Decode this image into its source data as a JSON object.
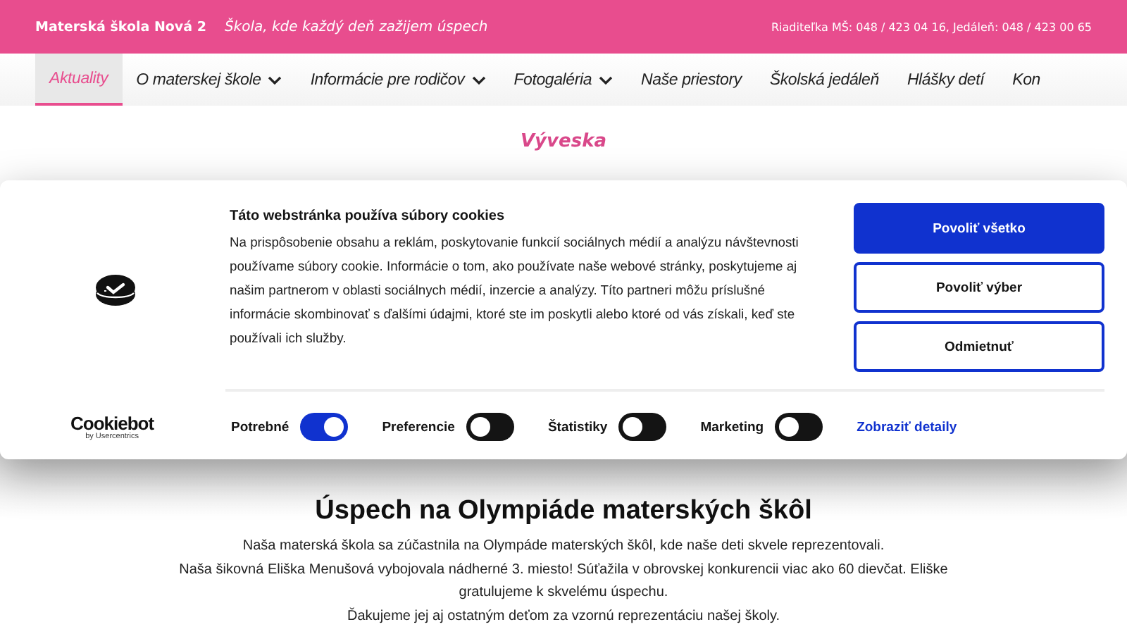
{
  "header": {
    "school_name": "Materská škola Nová 2",
    "motto": "Škola, kde každý deň zažijem úspech",
    "contacts": "Riaditeľka MŠ: 048 / 423 04 16, Jedáleň: 048 / 423 00 65"
  },
  "nav": [
    {
      "label": "Aktuality",
      "selected": true,
      "has_menu": false
    },
    {
      "label": "O materskej škole",
      "selected": false,
      "has_menu": true
    },
    {
      "label": "Informácie pre rodičov",
      "selected": false,
      "has_menu": true
    },
    {
      "label": "Fotogaléria",
      "selected": false,
      "has_menu": true
    },
    {
      "label": "Naše priestory",
      "selected": false,
      "has_menu": false
    },
    {
      "label": "Školská jedáleň",
      "selected": false,
      "has_menu": false
    },
    {
      "label": "Hlášky detí",
      "selected": false,
      "has_menu": false
    },
    {
      "label": "Kon",
      "selected": false,
      "has_menu": false
    }
  ],
  "page_title": "Výveska",
  "cookie_dialog": {
    "title": "Táto webstránka používa súbory cookies",
    "text": "Na prispôsobenie obsahu a reklám, poskytovanie funkcií sociálnych médií a analýzu návštevnosti používame súbory cookie. Informácie o tom, ako používate naše webové stránky, poskytujeme aj našim partnerom v oblasti sociálnych médií, inzercie a analýzy. Títo partneri môžu príslušné informácie skombinovať s ďalšími údajmi, ktoré ste im poskytli alebo ktoré od vás získali, keď ste používali ich služby.",
    "buttons": [
      {
        "label": "Povoliť všetko",
        "kind": "primary"
      },
      {
        "label": "Povoliť výber",
        "kind": "outline"
      },
      {
        "label": "Odmietnuť",
        "kind": "outline"
      }
    ],
    "brand": "Cookiebot",
    "brand_sub": "by Usercentrics",
    "toggles": [
      {
        "label": "Potrebné",
        "on": true
      },
      {
        "label": "Preferencie",
        "on": false
      },
      {
        "label": "Štatistiky",
        "on": false
      },
      {
        "label": "Marketing",
        "on": false
      }
    ],
    "details_link": "Zobraziť detaily"
  },
  "article": {
    "heading": "Úspech na Olympiáde materských škôl",
    "paragraphs": [
      "Naša materská škola sa zúčastnila na Olympáde materských škôl, kde naše deti skvele reprezentovali.",
      "Naša šikovná Eliška Menušová vybojovala nádherné 3. miesto! Súťažila v obrovskej konkurencii viac ako 60 dievčat. Eliške gratulujeme k skvelému úspechu.",
      "Ďakujeme jej aj ostatným deťom za vzornú reprezentáciu našej školy."
    ]
  }
}
